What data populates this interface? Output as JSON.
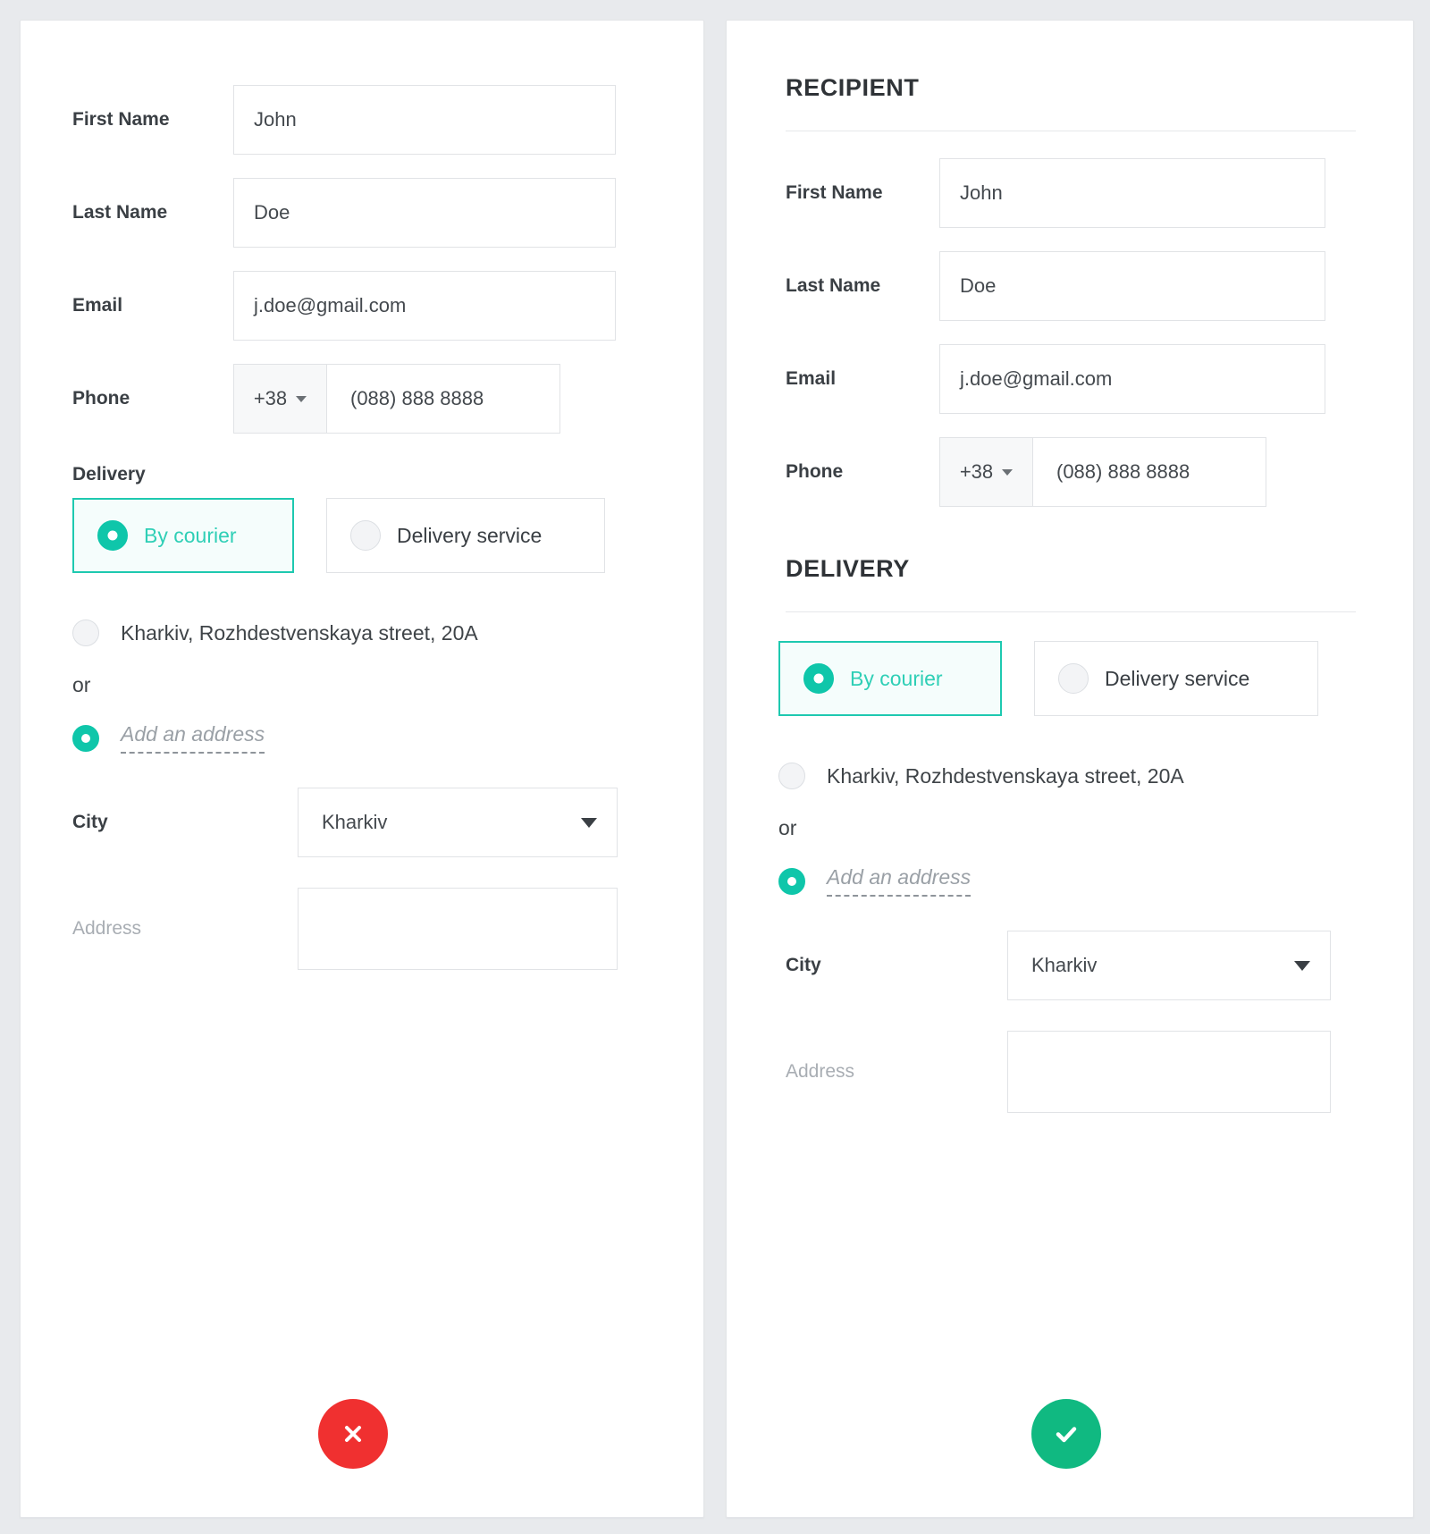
{
  "theme": {
    "background": "#e8eaed",
    "panel_bg": "#ffffff",
    "accent_teal": "#0fc6aa",
    "selected_border": "#1ec9b0",
    "cancel_red": "#f03030",
    "confirm_green": "#10b981"
  },
  "left_panel": {
    "fields": {
      "first_name": {
        "label": "First Name",
        "value": "John"
      },
      "last_name": {
        "label": "Last Name",
        "value": "Doe"
      },
      "email": {
        "label": "Email",
        "value": "j.doe@gmail.com"
      },
      "phone": {
        "label": "Phone",
        "country_code": "+38",
        "number": "(088) 888 8888"
      }
    },
    "delivery": {
      "group_label": "Delivery",
      "options": [
        {
          "label": "By courier",
          "selected": true
        },
        {
          "label": "Delivery service",
          "selected": false
        }
      ],
      "saved_address": {
        "label": "Kharkiv, Rozhdestvenskaya street, 20A",
        "selected": false
      },
      "or_label": "or",
      "add_address": {
        "label": "Add an address",
        "selected": true
      },
      "city": {
        "label": "City",
        "value": "Kharkiv"
      },
      "address": {
        "label": "Address",
        "value": "",
        "placeholder": ""
      }
    },
    "action": {
      "name": "cancel",
      "icon": "close-icon"
    }
  },
  "right_panel": {
    "recipient_heading": "RECIPIENT",
    "delivery_heading": "DELIVERY",
    "fields": {
      "first_name": {
        "label": "First Name",
        "value": "John"
      },
      "last_name": {
        "label": "Last Name",
        "value": "Doe"
      },
      "email": {
        "label": "Email",
        "value": "j.doe@gmail.com"
      },
      "phone": {
        "label": "Phone",
        "country_code": "+38",
        "number": "(088) 888 8888"
      }
    },
    "delivery": {
      "options": [
        {
          "label": "By courier",
          "selected": true
        },
        {
          "label": "Delivery service",
          "selected": false
        }
      ],
      "saved_address": {
        "label": "Kharkiv, Rozhdestvenskaya street, 20A",
        "selected": false
      },
      "or_label": "or",
      "add_address": {
        "label": "Add an address",
        "selected": true
      },
      "city": {
        "label": "City",
        "value": "Kharkiv"
      },
      "address": {
        "label": "Address",
        "value": "",
        "placeholder": ""
      }
    },
    "action": {
      "name": "confirm",
      "icon": "check-icon"
    }
  }
}
